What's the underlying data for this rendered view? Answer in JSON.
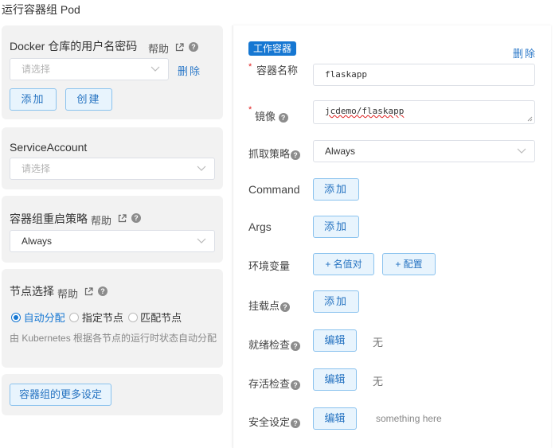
{
  "page": {
    "title": "运行容器组 Pod"
  },
  "left": {
    "docker": {
      "label": "Docker 仓库的用户名密码",
      "help": "帮助",
      "select_placeholder": "请选择",
      "delete": "删除",
      "add": "添加",
      "create": "创建"
    },
    "service_account": {
      "label": "ServiceAccount",
      "select_placeholder": "请选择"
    },
    "restart_policy": {
      "label": "容器组重启策略",
      "help": "帮助",
      "value": "Always"
    },
    "node_select": {
      "label": "节点选择",
      "help": "帮助",
      "options": [
        "自动分配",
        "指定节点",
        "匹配节点"
      ],
      "selected": "自动分配",
      "description": "由 Kubernetes 根据各节点的运行时状态自动分配"
    },
    "more_settings": "容器组的更多设定"
  },
  "right": {
    "tag": "工作容器",
    "delete": "删除",
    "fields": {
      "container_name": {
        "label": "容器名称",
        "value": "flaskapp"
      },
      "image": {
        "label": "镜像",
        "value": "jcdemo/flaskapp"
      },
      "pull_policy": {
        "label": "抓取策略",
        "value": "Always"
      },
      "command": {
        "label": "Command",
        "button": "添加"
      },
      "args": {
        "label": "Args",
        "button": "添加"
      },
      "env": {
        "label": "环境变量",
        "button_kv": "+ 名值对",
        "button_config": "+ 配置"
      },
      "mounts": {
        "label": "挂载点",
        "button": "添加"
      },
      "readiness": {
        "label": "就绪检查",
        "button": "编辑",
        "value": "无"
      },
      "liveness": {
        "label": "存活检查",
        "button": "编辑",
        "value": "无"
      },
      "security": {
        "label": "安全设定",
        "button": "编辑",
        "value": "something here"
      }
    }
  },
  "colors": {
    "accent": "#1677d2",
    "button_bg": "#e8f4fd",
    "button_border": "#8ac2ee",
    "panel_bg": "#f2f2f2",
    "required": "#e02020"
  },
  "icons": [
    "external-link-icon",
    "help-circle-icon",
    "chevron-down-icon",
    "radio-selected-icon",
    "radio-unselected-icon"
  ]
}
